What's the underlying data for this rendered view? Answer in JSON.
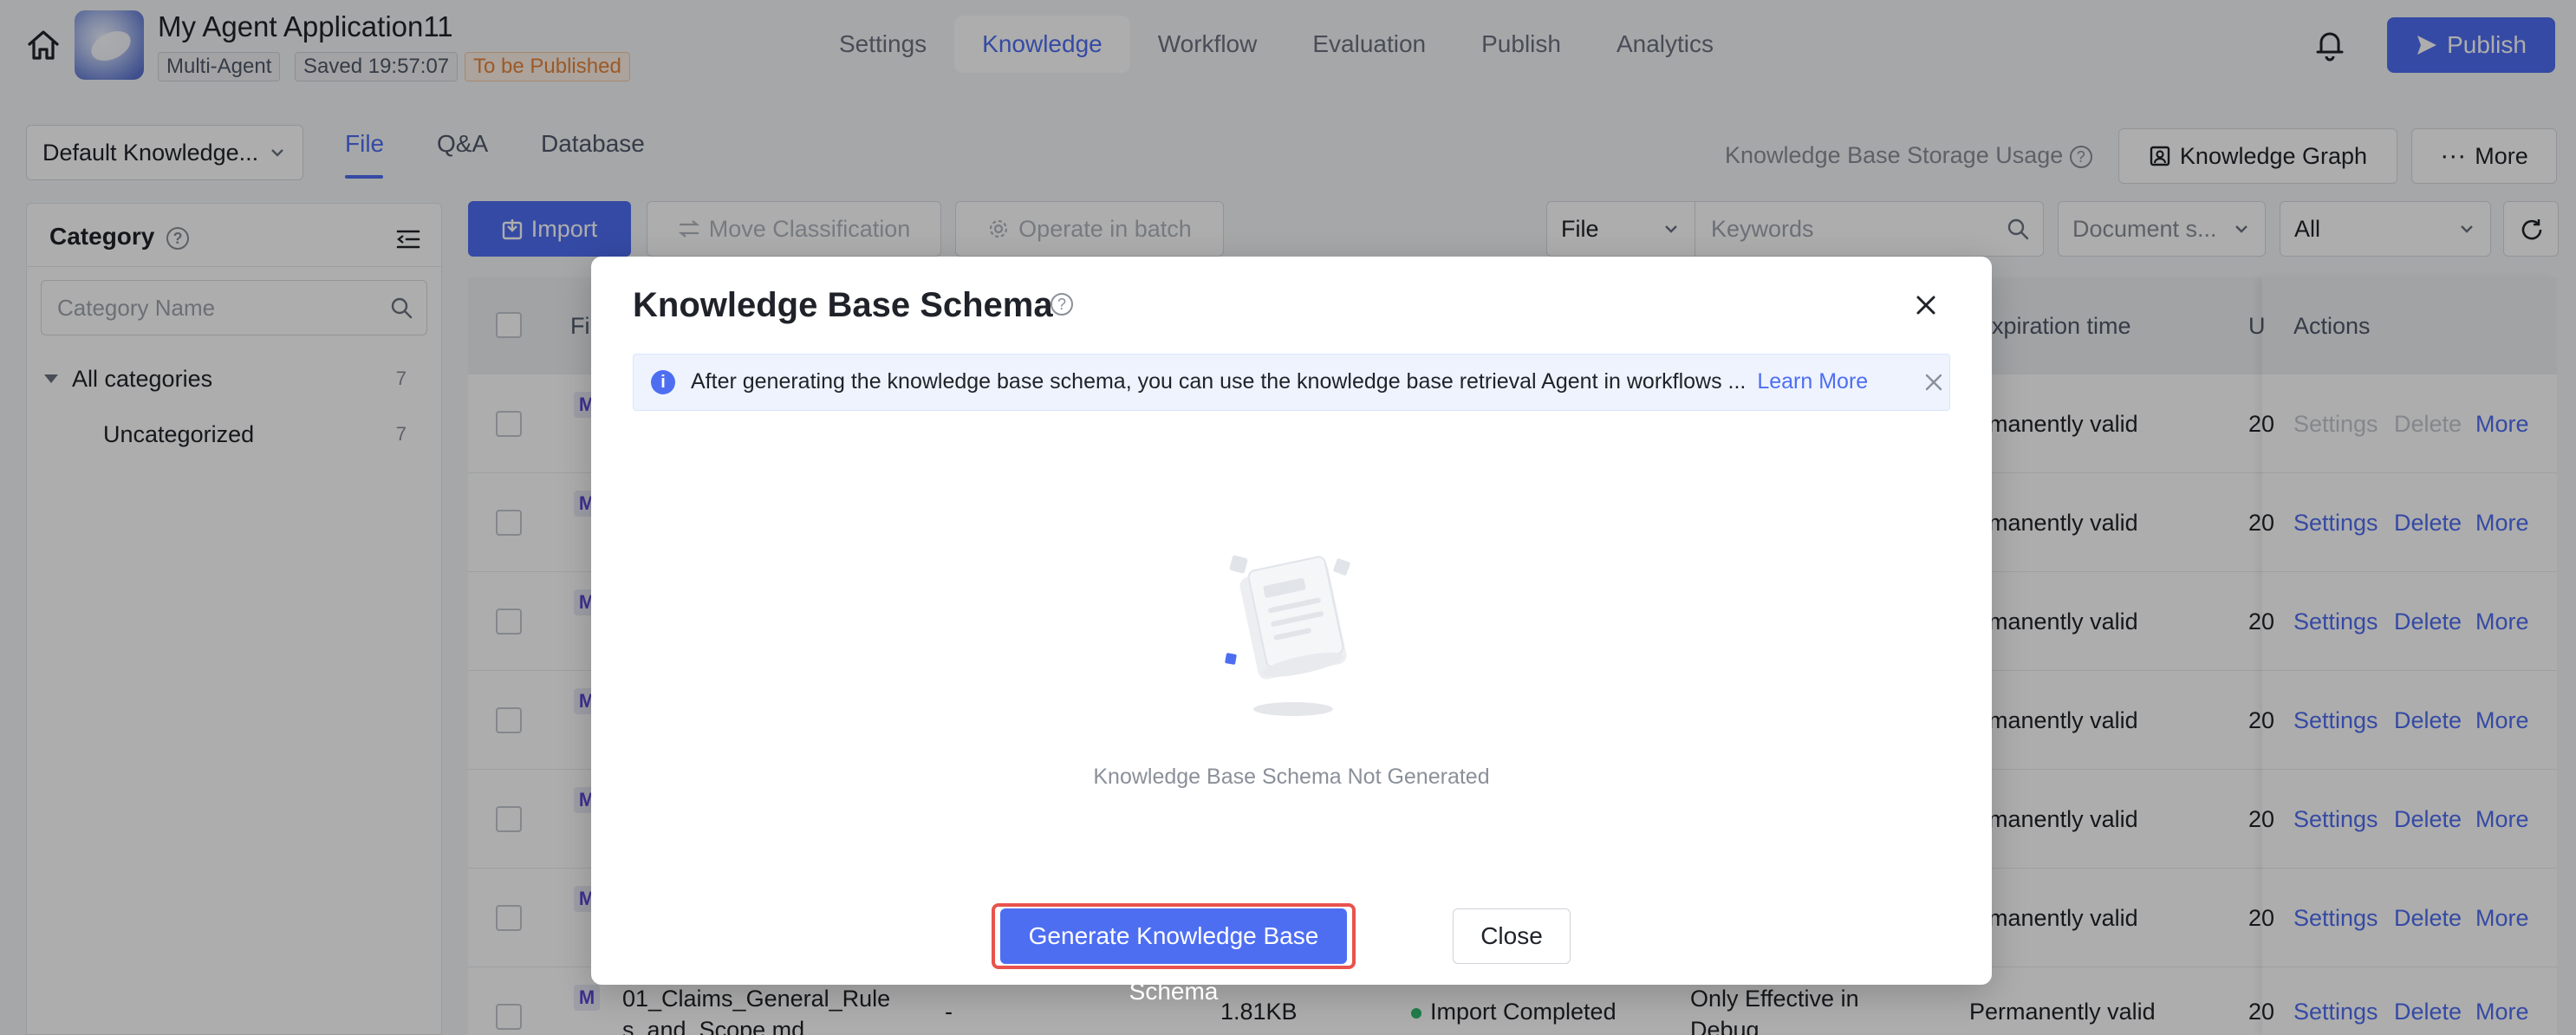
{
  "header": {
    "app_title": "My Agent Application11",
    "tags": {
      "mode": "Multi-Agent",
      "saved": "Saved 19:57:07",
      "status": "To be Published"
    },
    "nav": [
      "Settings",
      "Knowledge",
      "Workflow",
      "Evaluation",
      "Publish",
      "Analytics"
    ],
    "active_nav": "Knowledge",
    "publish_label": "Publish"
  },
  "toolbar": {
    "kb_select": "Default Knowledge...",
    "tabs": [
      "File",
      "Q&A",
      "Database"
    ],
    "active_tab": "File",
    "storage_label": "Knowledge Base Storage Usage",
    "knowledge_graph_label": "Knowledge Graph",
    "more_label": "More"
  },
  "category": {
    "title": "Category",
    "search_placeholder": "Category Name",
    "items": [
      {
        "label": "All categories",
        "count": "7"
      },
      {
        "label": "Uncategorized",
        "count": "7"
      }
    ]
  },
  "table_toolbar": {
    "import_label": "Import",
    "move_label": "Move Classification",
    "batch_label": "Operate in batch",
    "filter_type": "File",
    "keywords_placeholder": "Keywords",
    "doc_status": "Document s...",
    "all_filter": "All"
  },
  "table": {
    "headers": {
      "file": "Fi",
      "expiration": "xpiration time",
      "updated": "U",
      "actions": "Actions"
    },
    "row_expiration": "ermanently valid",
    "row_updated": "20",
    "actions": {
      "settings": "Settings",
      "delete": "Delete",
      "more": "More"
    },
    "last_row": {
      "name_line1": "01_Claims_General_Rule",
      "name_line2": "s_and_Scope.md",
      "dash": "-",
      "size": "1.81KB",
      "status": "Import Completed",
      "effect_line1": "Only Effective in",
      "effect_line2": "Debug",
      "expiration": "Permanently valid"
    }
  },
  "modal": {
    "title": "Knowledge Base Schema",
    "banner_text": "After generating the knowledge base schema, you can use the knowledge base retrieval Agent in workflows ...",
    "learn_more": "Learn More",
    "empty_text": "Knowledge Base Schema Not Generated",
    "generate_label": "Generate Knowledge Base Schema",
    "close_label": "Close"
  },
  "colors": {
    "accent": "#4e6ef2",
    "highlight": "#e8534d",
    "pending": "#e8843a",
    "success": "#2fb86b"
  }
}
